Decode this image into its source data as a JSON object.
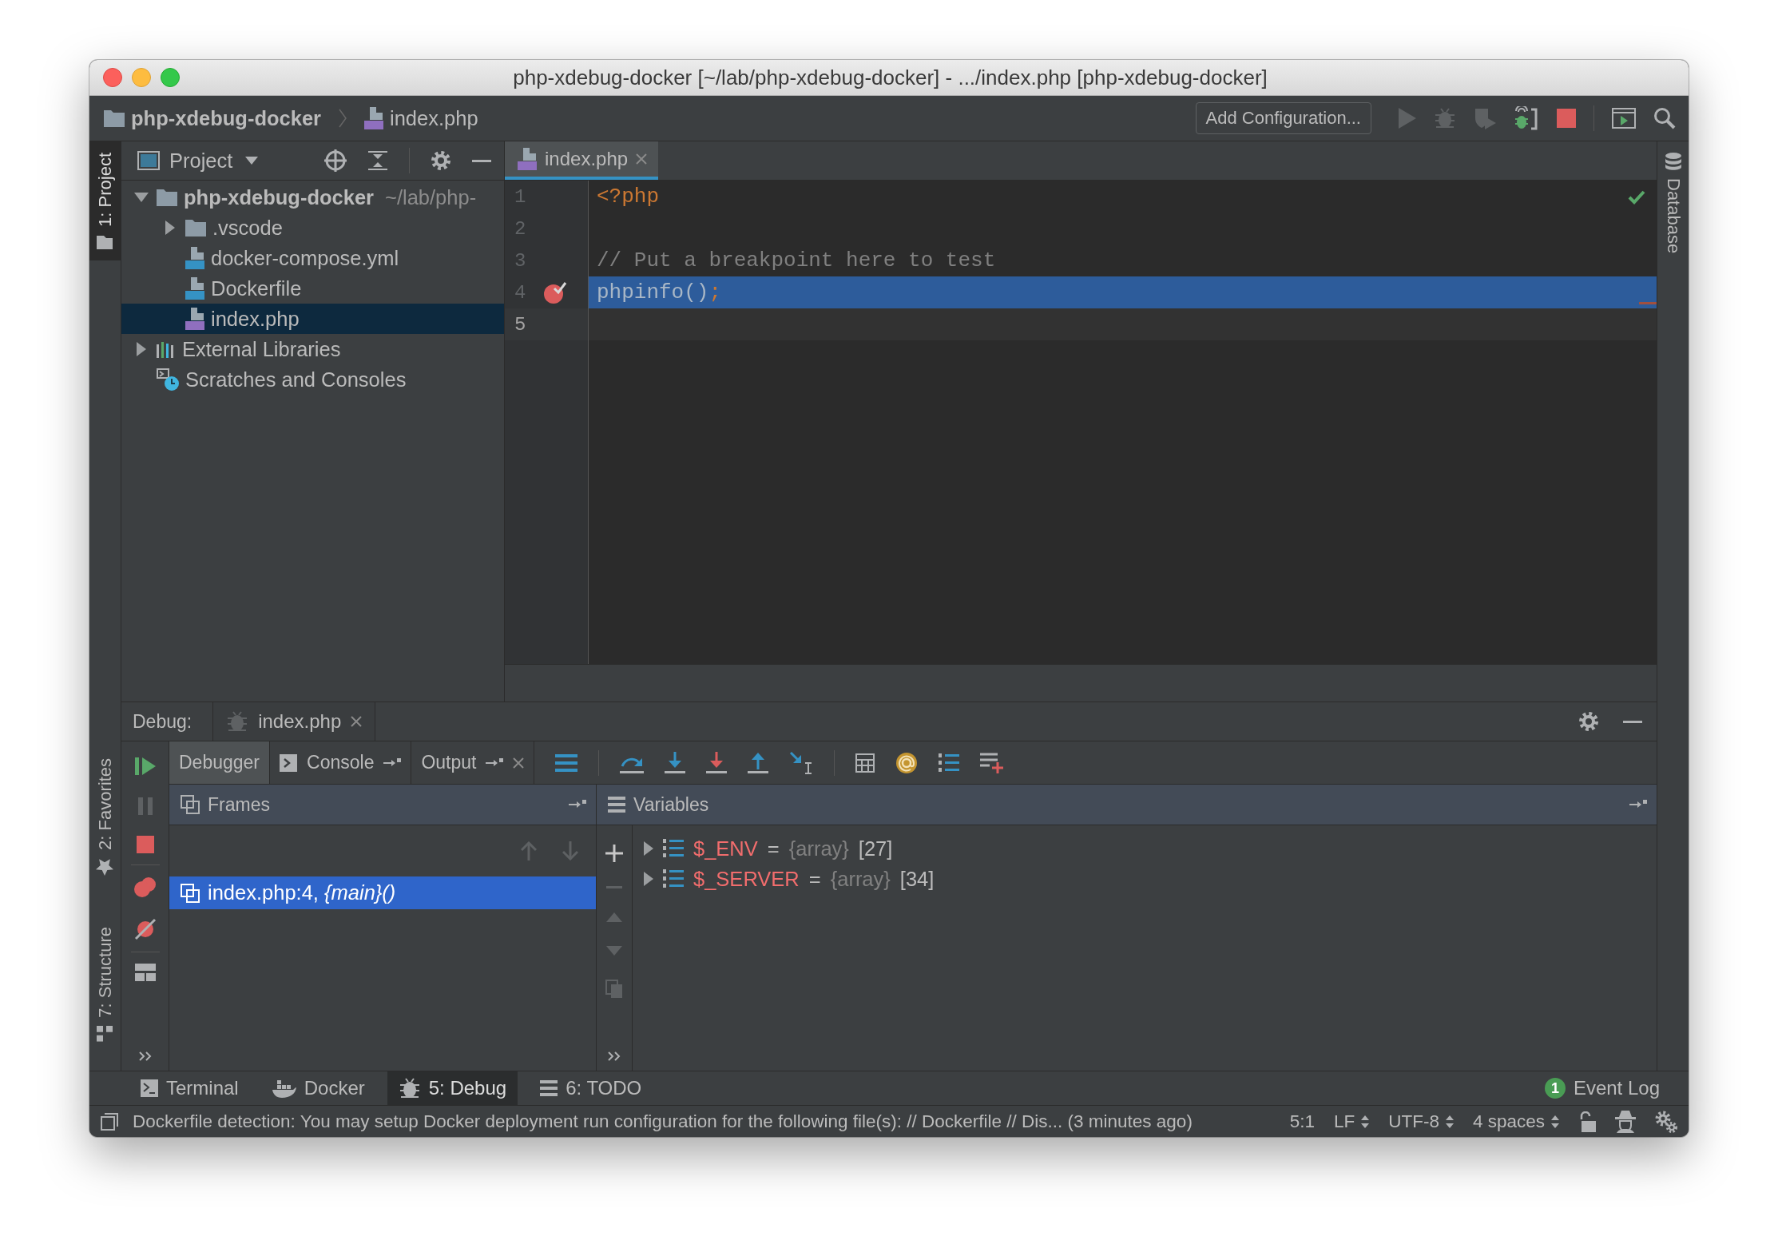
{
  "window": {
    "title": "php-xdebug-docker [~/lab/php-xdebug-docker] - .../index.php [php-xdebug-docker]"
  },
  "navbar": {
    "breadcrumbs": [
      {
        "label": "php-xdebug-docker",
        "kind": "folder"
      },
      {
        "label": "index.php",
        "kind": "php"
      }
    ],
    "run_configuration": "Add Configuration..."
  },
  "stripes": {
    "left_top": [
      {
        "label": "1: Project",
        "kind": "project",
        "selected": true
      }
    ],
    "left_bottom": [
      {
        "label": "2: Favorites",
        "kind": "favorites",
        "selected": false
      },
      {
        "label": "7: Structure",
        "kind": "structure",
        "selected": false
      }
    ],
    "right": [
      {
        "label": "Database",
        "kind": "database",
        "selected": false
      }
    ]
  },
  "project": {
    "title": "Project",
    "tree": [
      {
        "label": "php-xdebug-docker",
        "path": "~/lab/php-",
        "kind": "folder",
        "expanded": true,
        "selected": false,
        "children": [
          {
            "label": ".vscode",
            "kind": "folder",
            "expanded": false,
            "selected": false
          },
          {
            "label": "docker-compose.yml",
            "kind": "compose",
            "selected": false
          },
          {
            "label": "Dockerfile",
            "kind": "docker",
            "selected": false
          },
          {
            "label": "index.php",
            "kind": "php",
            "selected": true
          }
        ]
      },
      {
        "label": "External Libraries",
        "kind": "libraries",
        "expanded": false,
        "selected": false
      },
      {
        "label": "Scratches and Consoles",
        "kind": "scratches",
        "selected": false
      }
    ]
  },
  "editor": {
    "tabs": [
      {
        "label": "index.php",
        "kind": "php",
        "selected": true
      }
    ],
    "lines": [
      {
        "number": "1",
        "breakpoint": false,
        "execution_point": false,
        "caret": false,
        "tokens": [
          {
            "text": "<?php",
            "kind": "keyword"
          }
        ]
      },
      {
        "number": "2",
        "breakpoint": false,
        "execution_point": false,
        "caret": false
      },
      {
        "number": "3",
        "breakpoint": false,
        "execution_point": false,
        "caret": false,
        "tokens": [
          {
            "text": "// Put a breakpoint here to test",
            "kind": "comment"
          }
        ]
      },
      {
        "number": "4",
        "breakpoint": true,
        "execution_point": true,
        "caret": false,
        "tokens": [
          {
            "text": "phpinfo()",
            "kind": "plain"
          },
          {
            "text": ";",
            "kind": "keyword"
          }
        ]
      },
      {
        "number": "5",
        "breakpoint": false,
        "execution_point": false,
        "caret": true
      }
    ]
  },
  "debug": {
    "label": "Debug:",
    "sessions": [
      {
        "label": "index.php",
        "selected": true
      }
    ],
    "tabs": [
      {
        "label": "Debugger",
        "kind": "debugger",
        "selected": true
      },
      {
        "label": "Console",
        "kind": "console",
        "selected": false
      },
      {
        "label": "Output",
        "kind": "output",
        "selected": false
      }
    ],
    "frames": {
      "title": "Frames",
      "items": [
        {
          "text": "index.php:4, *{main}()*",
          "selected": true
        }
      ]
    },
    "variables": {
      "title": "Variables",
      "items": [
        {
          "name": "$_ENV",
          "operator": "=",
          "type": "{array}",
          "count": "[27]",
          "expanded": false
        },
        {
          "name": "$_SERVER",
          "operator": "=",
          "type": "{array}",
          "count": "[34]",
          "expanded": false
        }
      ]
    }
  },
  "tool_windows": {
    "items": [
      {
        "label": "Terminal",
        "kind": "terminal",
        "selected": false
      },
      {
        "label": "Docker",
        "kind": "docker",
        "selected": false
      },
      {
        "label": "5: Debug",
        "kind": "debug",
        "selected": true
      },
      {
        "label": "6: TODO",
        "kind": "todo",
        "selected": false
      }
    ],
    "event_log": {
      "label": "Event Log",
      "count": "1"
    }
  },
  "status_bar": {
    "message": "Dockerfile detection: You may setup Docker deployment run configuration for the following file(s): // Dockerfile // Dis... (3 minutes ago)",
    "fields": [
      {
        "text": "5:1",
        "dropdown": false
      },
      {
        "text": "LF",
        "dropdown": true
      },
      {
        "text": "UTF-8",
        "dropdown": true
      },
      {
        "text": "4 spaces",
        "dropdown": true
      }
    ]
  }
}
